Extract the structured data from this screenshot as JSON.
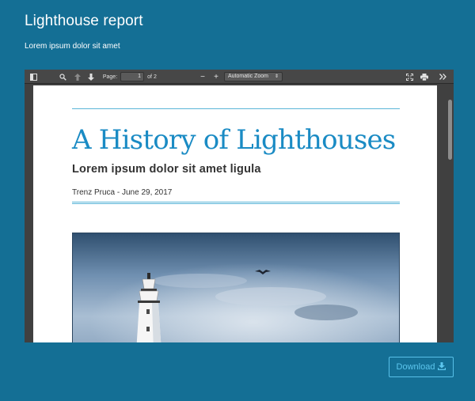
{
  "header": {
    "title": "Lighthouse report",
    "subtitle": "Lorem ipsum dolor sit amet"
  },
  "pdf_viewer": {
    "toolbar": {
      "sidebar_toggle_icon": "sidebar-icon",
      "search_icon": "magnifier-icon",
      "prev_icon": "arrow-up-icon",
      "next_icon": "arrow-down-icon",
      "page_label": "Page:",
      "page_value": "1",
      "page_count": "of 2",
      "zoom_out": "−",
      "zoom_in": "+",
      "zoom_value": "Automatic Zoom",
      "fullscreen_icon": "presentation-mode-icon",
      "print_icon": "printer-icon",
      "more_icon": "double-chevron-right-icon"
    },
    "document": {
      "title": "A History of Lighthouses",
      "subtitle": "Lorem ipsum dolor sit amet ligula",
      "byline": "Trenz Pruca - June 29, 2017"
    }
  },
  "download": {
    "label": "Download",
    "icon": "download-icon"
  },
  "colors": {
    "background": "#146f95",
    "accent": "#1a8bc4",
    "button_border": "#58c0e8"
  }
}
